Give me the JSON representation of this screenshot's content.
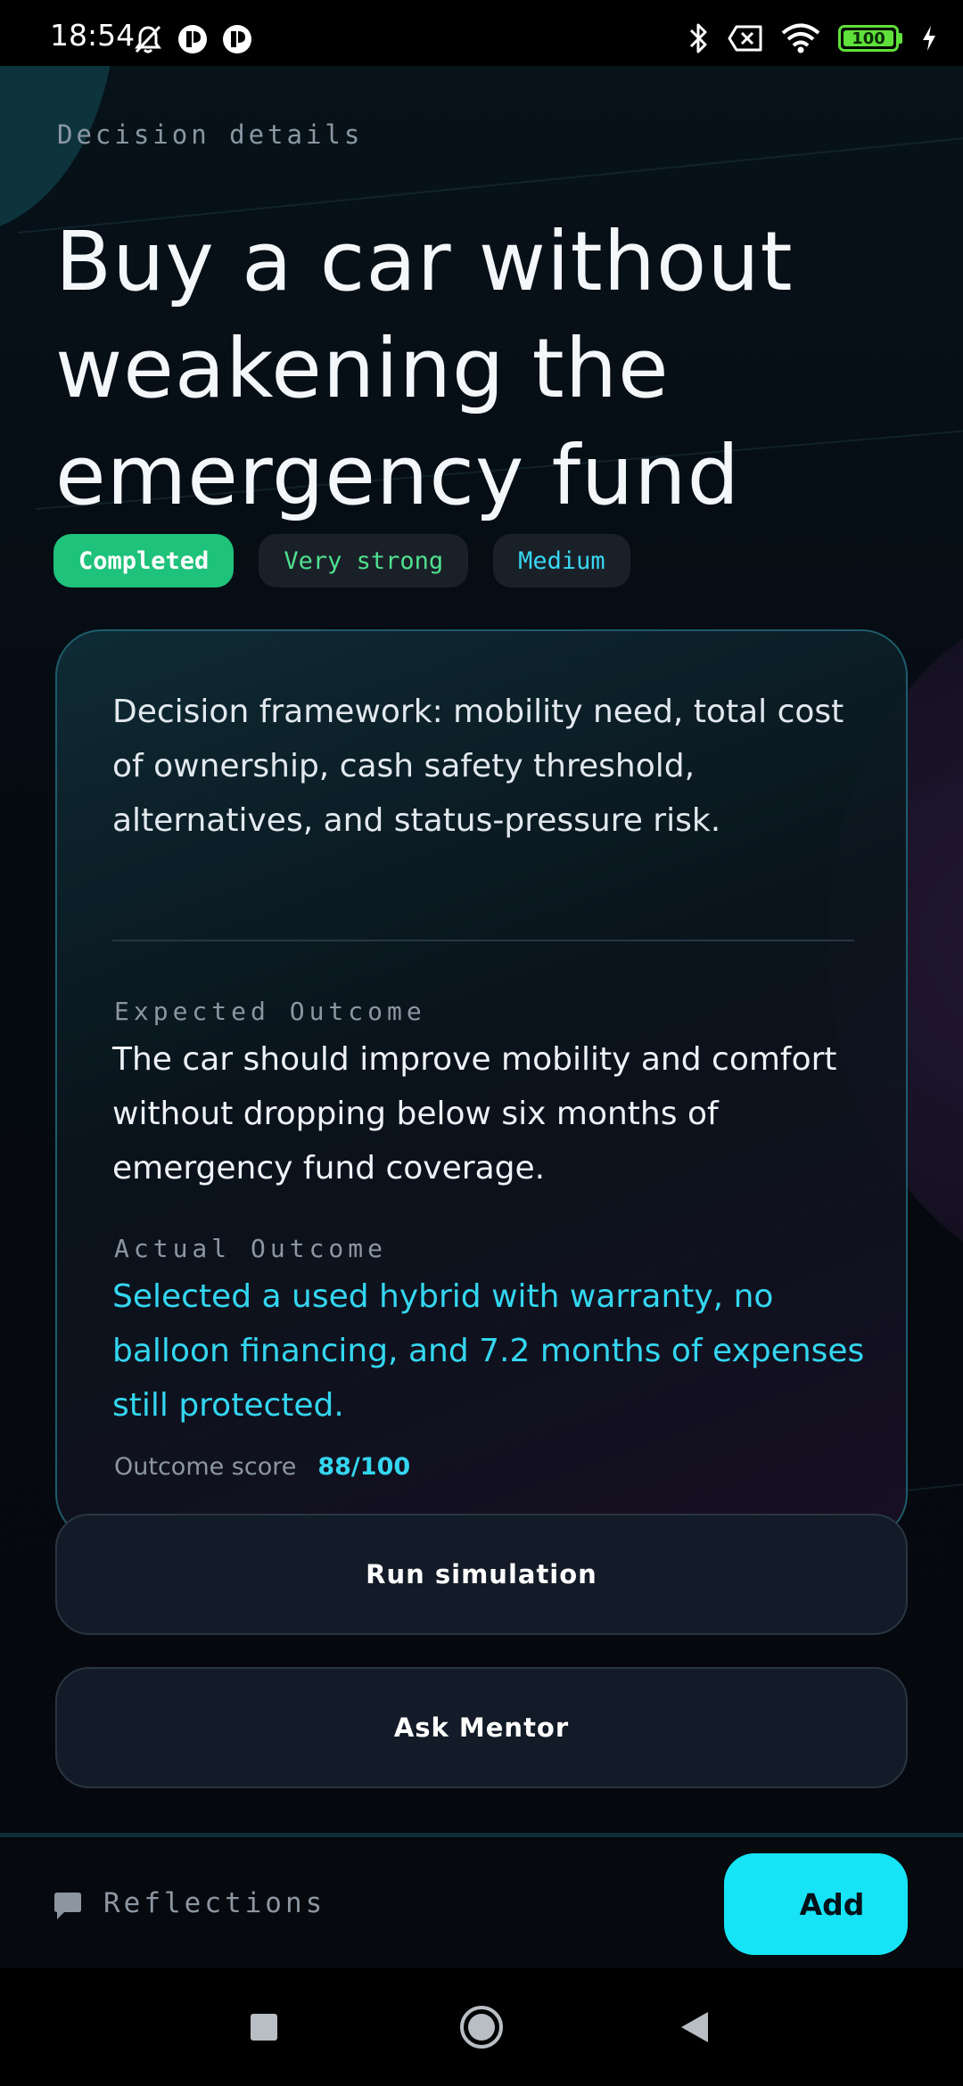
{
  "status_bar": {
    "time": "18:54",
    "battery": "100",
    "colors": {
      "battery": "#5fe03a"
    }
  },
  "header": {
    "eyebrow": "Decision details",
    "title": "Buy a car without weakening the emergency fund"
  },
  "chips": [
    {
      "label": "Completed",
      "color": "#1fc27a"
    },
    {
      "label": "Very strong",
      "color": "#4fe08f"
    },
    {
      "label": "Medium",
      "color": "#39d7f2"
    }
  ],
  "card": {
    "framework": "Decision framework: mobility need, total cost of ownership, cash safety threshold, alternatives, and status-pressure risk.",
    "expected_label": "Expected Outcome",
    "expected_text": "The car should improve mobility and comfort without dropping below six months of emergency fund coverage.",
    "actual_label": "Actual Outcome",
    "actual_text": "Selected a used hybrid with warranty, no balloon financing, and 7.2 months of expenses still protected.",
    "score_label": "Outcome score",
    "score_value": "88/100"
  },
  "actions": {
    "simulate_label": "Run simulation",
    "mentor_label": "Ask Mentor"
  },
  "bottom": {
    "reflections_label": "Reflections",
    "reflections_icon": "chat-bubble-icon",
    "add_label": "Add",
    "colors": {
      "accent": "#16e3f6"
    }
  },
  "nav": {
    "icons": [
      "recents-square-icon",
      "home-circle-icon",
      "back-triangle-icon"
    ]
  }
}
